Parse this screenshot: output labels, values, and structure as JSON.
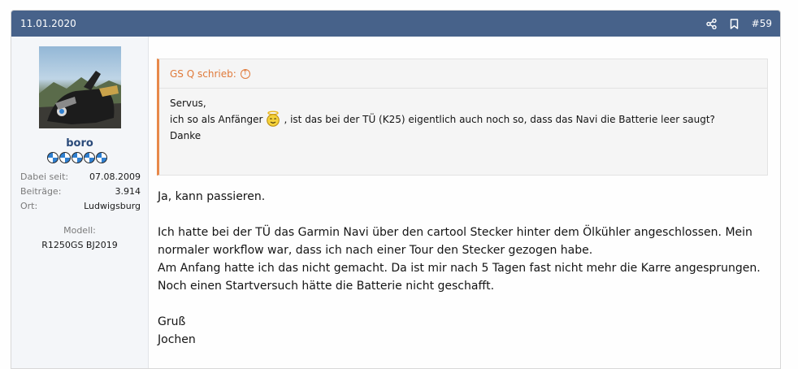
{
  "post": {
    "date": "11.01.2020",
    "number": "#59",
    "icons": {
      "share": "share-icon",
      "bookmark": "bookmark-icon"
    }
  },
  "author": {
    "username": "boro",
    "stats": [
      {
        "label": "Dabei seit:",
        "value": "07.08.2009"
      },
      {
        "label": "Beiträge:",
        "value": "3.914"
      },
      {
        "label": "Ort:",
        "value": "Ludwigsburg"
      }
    ],
    "model_label": "Modell:",
    "model_value": "R1250GS BJ2019"
  },
  "quote": {
    "author_line": "GS Q schrieb:",
    "line1": "Servus,",
    "line2_before": "ich so als Anfänger",
    "line2_after": ", ist das bei der TÜ (K25) eigentlich auch noch so, dass das Navi die Batterie leer saugt?",
    "line3": "Danke"
  },
  "message": {
    "lines": [
      "Ja, kann passieren.",
      "",
      "Ich hatte bei der TÜ das Garmin Navi über den cartool Stecker hinter dem Ölkühler angeschlossen. Mein",
      "normaler workflow war, dass ich nach einer Tour den Stecker gezogen habe.",
      "Am Anfang hatte ich das nicht gemacht. Da ist mir nach 5 Tagen fast nicht mehr die Karre angesprungen.",
      "Noch einen Startversuch hätte die Batterie nicht geschafft.",
      "",
      "Gruß",
      "Jochen"
    ]
  },
  "colors": {
    "header_bg": "#47628a",
    "quote_accent": "#e07a3a",
    "username": "#2a4a7a",
    "user_col_bg": "#f4f6f9"
  }
}
